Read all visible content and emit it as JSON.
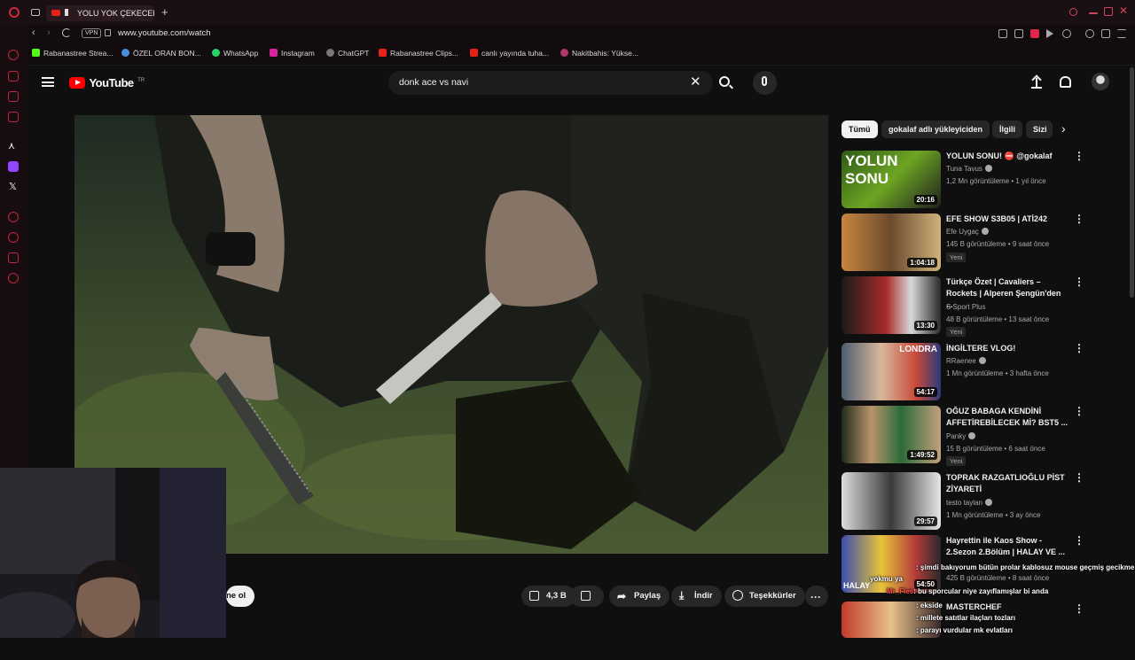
{
  "browser": {
    "tab_title": "YOLU YOK ÇEKECEK",
    "url": "www.youtube.com/watch",
    "vpn_label": "VPN",
    "bookmarks": [
      "Rabanastree Strea...",
      "ÖZEL ORAN BON...",
      "WhatsApp",
      "Instagram",
      "ChatGPT",
      "Rabanastree Clips...",
      "canlı yayında tuha...",
      "Nakitbahis: Yükse..."
    ]
  },
  "youtube": {
    "logo": "YouTube",
    "region": "TR",
    "search_query": "donk ace vs navi"
  },
  "actions": {
    "subscribe_partial": "ne ol",
    "likes": "4,3 B",
    "share": "Paylaş",
    "download": "İndir",
    "thanks": "Teşekkürler"
  },
  "chips": [
    "Tümü",
    "gokalaf adlı yükleyiciden",
    "İlgili",
    "Sizi"
  ],
  "recommendations": [
    {
      "title": "YOLUN SONU! ⛔ @gokalaf",
      "channel": "Tuna Tavus",
      "meta": "1,2 Mn görüntüleme • 1 yıl önce",
      "duration": "20:16",
      "badge": ""
    },
    {
      "title": "EFE SHOW S3B05 | ATİ242",
      "channel": "Efe Uygaç",
      "meta": "145 B görüntüleme • 9 saat önce",
      "duration": "1:04:18",
      "badge": "Yeni"
    },
    {
      "title": "Türkçe Özet | Cavaliers – Rockets | Alperen Şengün'den ...",
      "channel": "S Sport Plus",
      "meta": "48 B görüntüleme • 13 saat önce",
      "duration": "13:30",
      "badge": "Yeni"
    },
    {
      "title": "İNGİLTERE VLOG!",
      "channel": "RRaenee",
      "meta": "1 Mn görüntüleme • 3 hafta önce",
      "duration": "54:17",
      "badge": ""
    },
    {
      "title": "OĞUZ BABAGA KENDİNİ AFFETİREBİLECEK Mİ? BST5 ...",
      "channel": "Panky",
      "meta": "15 B görüntüleme • 6 saat önce",
      "duration": "1:49:52",
      "badge": "Yeni"
    },
    {
      "title": "TOPRAK RAZGATLIOĞLU PİST ZİYARETİ",
      "channel": "testo taylan",
      "meta": "1 Mn görüntüleme • 3 ay önce",
      "duration": "29:57",
      "badge": ""
    },
    {
      "title": "Hayrettin ile Kaos Show - 2.Sezon 2.Bölüm | HALAY VE ...",
      "channel": "",
      "meta": "425 B görüntüleme • 8 saat önce",
      "duration": "54:50",
      "badge": ""
    },
    {
      "title": "MASTERCHEF",
      "channel": "",
      "meta": "",
      "duration": "",
      "badge": ""
    }
  ],
  "chat": [
    {
      "user": "",
      "text": ": şimdi bakıyorum bütün prolar kablosuz mouse geçmiş gecikme"
    },
    {
      "user": "",
      "text": "yokmu ya"
    },
    {
      "user": "Mr_Fles",
      "text": ": bu sporcular niye zayıflamışlar bi anda"
    },
    {
      "user": "",
      "text": ": ekside"
    },
    {
      "user": "",
      "text": ": millete satıtlar ilaçları tozları"
    },
    {
      "user": "",
      "text": ": parayı vurdular mk evlatları"
    }
  ]
}
